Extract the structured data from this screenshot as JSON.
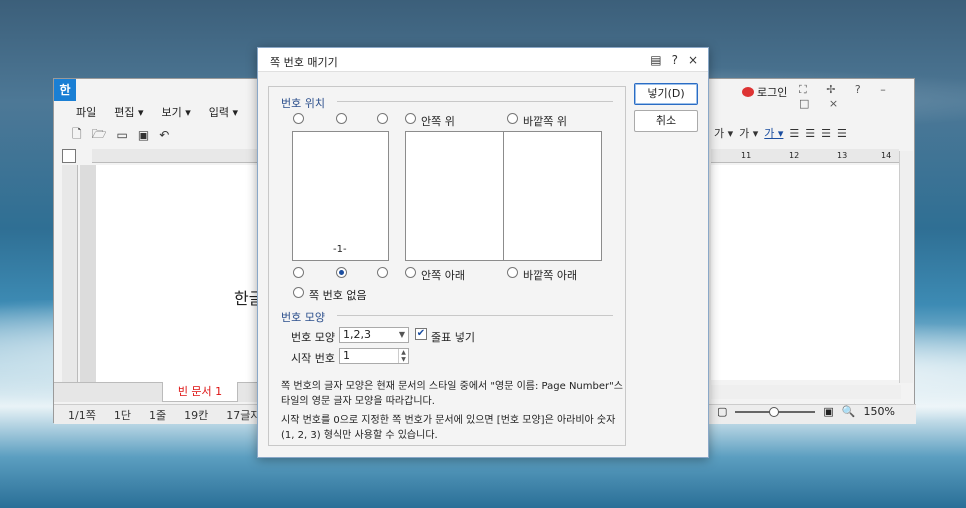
{
  "app": {
    "logo": "한",
    "menu": [
      "파일",
      "편집 ▾",
      "보기 ▾",
      "입력 ▾"
    ],
    "login": "로그인",
    "ruler_numbers": [
      "11",
      "12",
      "13",
      "14"
    ],
    "doc_text": "한글",
    "doc_tab": "빈 문서 1",
    "status": [
      "1/1쪽",
      "1단",
      "1줄",
      "19칸",
      "17글자"
    ],
    "zoom": "150%"
  },
  "dialog": {
    "title": "쪽 번호 매기기",
    "insert_button": "넣기(D)",
    "cancel_button": "취소",
    "position_section": "번호 위치",
    "pos_inside_top": "안쪽 위",
    "pos_outside_top": "바깥쪽 위",
    "pos_inside_bottom": "안쪽 아래",
    "pos_outside_bottom": "바깥쪽 아래",
    "pos_none": "쪽 번호 없음",
    "preview_number": "-1-",
    "shape_section": "번호 모양",
    "shape_label": "번호 모양",
    "shape_value": "1,2,3",
    "dash_label": "줄표 넣기",
    "dash_checked": true,
    "start_label": "시작 번호",
    "start_value": "1",
    "note1_line1": "쪽 번호의 글자 모양은 현재 문서의 스타일 중에서 \"영문 이름: Page Number\"스",
    "note1_line2": "타일의 영문 글자 모양을 따라갑니다.",
    "note2_line1": "시작 번호를 0으로 지정한 쪽 번호가 문서에 있으면 [번호 모양]은 아라비아 숫자",
    "note2_line2": "(1, 2, 3) 형식만 사용할 수 있습니다."
  }
}
